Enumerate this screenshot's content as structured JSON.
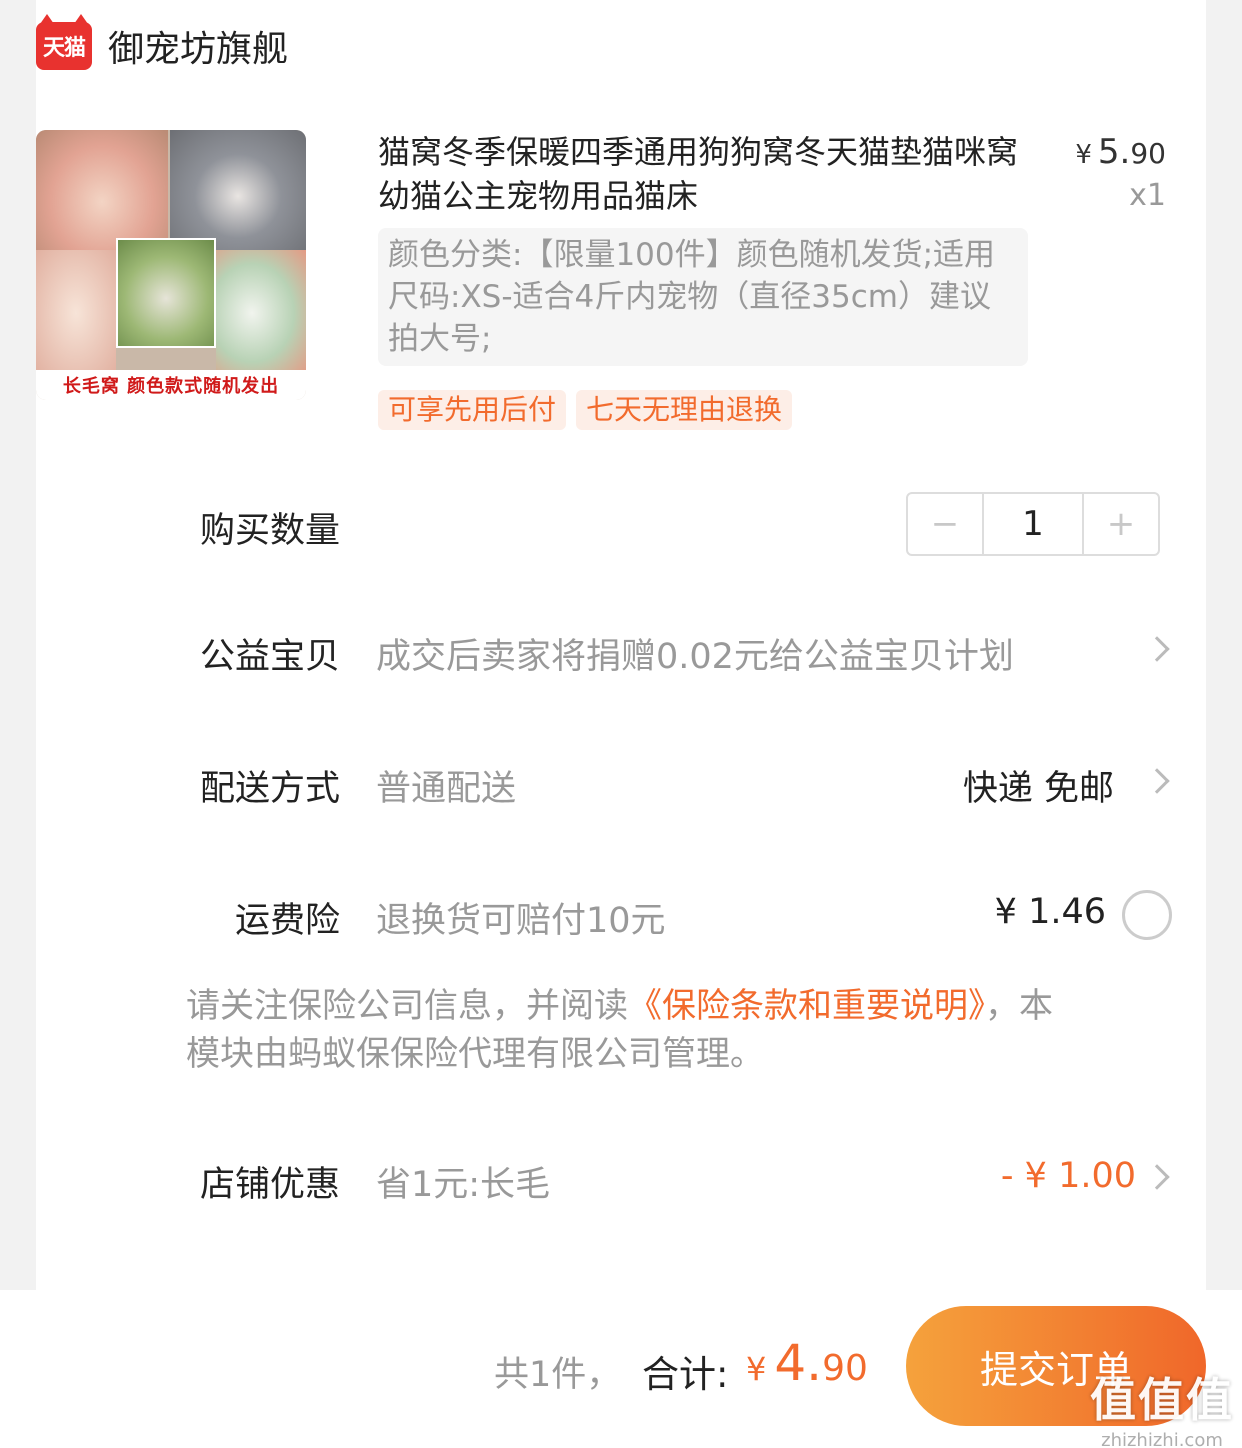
{
  "store": {
    "logo_text": "天猫",
    "name": "御宠坊旗舰"
  },
  "product": {
    "image_caption": "长毛窝 颜色款式随机发出",
    "title": "猫窝冬季保暖四季通用狗狗窝冬天猫垫猫咪窝幼猫公主宠物用品猫床",
    "price_currency": "¥",
    "price_int": "5.",
    "price_dec": "90",
    "quantity_tag": "x1",
    "sku": "颜色分类:【限量100件】颜色随机发货;适用尺码:XS-适合4斤内宠物（直径35cm）建议拍大号;",
    "tags": [
      "可享先用后付",
      "七天无理由退换"
    ]
  },
  "quantity": {
    "label": "购买数量",
    "minus": "−",
    "value": "1",
    "plus": "+"
  },
  "charity": {
    "label": "公益宝贝",
    "value": "成交后卖家将捐赠0.02元给公益宝贝计划"
  },
  "delivery": {
    "label": "配送方式",
    "value": "普通配送",
    "right": "快递 免邮"
  },
  "insurance": {
    "label": "运费险",
    "value": "退换货可赔付10元",
    "price": "¥ 1.46"
  },
  "notice": {
    "prefix": "请关注保险公司信息，并阅读",
    "link": "《保险条款和重要说明》",
    "suffix": "，本模块由蚂蚁保保险代理有限公司管理。"
  },
  "shop_discount": {
    "label": "店铺优惠",
    "value": "省1元:长毛",
    "amount": "- ¥ 1.00"
  },
  "footer": {
    "count": "共1件，",
    "total_label": "合计:",
    "total_currency": "¥",
    "total_int": "4.",
    "total_dec": "90",
    "submit": "提交订单"
  },
  "watermark": {
    "main": "值值值",
    "sub": "zhizhizhi.com"
  },
  "colors": {
    "accent": "#f26b2d",
    "tmall_red": "#e8322f",
    "button_from": "#f5a23c",
    "button_to": "#f0672a"
  }
}
